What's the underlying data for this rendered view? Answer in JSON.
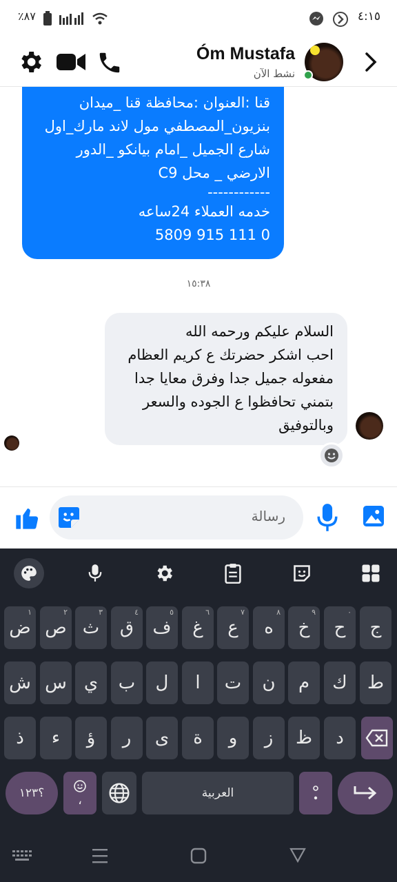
{
  "status": {
    "time": "٤:١٥",
    "battery": "٪٨٧"
  },
  "header": {
    "name": "Óm Mustafa",
    "sub": "نشط الآن"
  },
  "blue_message": {
    "lines": [
      "قنا :العنوان :محافظة قنا _ميدان",
      "بنزيون_المصطفي مول لاند مارك_اول",
      "شارع الجميل _امام بيانكو _الدور",
      "الارضي _ محل C9",
      "------------",
      "خدمه العملاء 24ساعه",
      "0 111 915 5809"
    ]
  },
  "timestamp": "١٥:٣٨",
  "gray_message": {
    "lines": [
      "السلام عليكم ورحمه الله",
      "احب اشكر حضرتك ع كريم العظام",
      "مفعوله جميل جدا وفرق معايا جدا",
      "بتمني تحافظوا ع الجوده والسعر",
      "وبالتوفيق"
    ]
  },
  "composer": {
    "placeholder": "رسالة"
  },
  "keyboard": {
    "row1": [
      "ج",
      "ح",
      "خ",
      "ه",
      "ع",
      "غ",
      "ف",
      "ق",
      "ث",
      "ص",
      "ض"
    ],
    "row1_digits": [
      "",
      "٠",
      "٩",
      "٨",
      "٧",
      "٦",
      "٥",
      "٤",
      "٣",
      "٢",
      "١"
    ],
    "row2": [
      "ط",
      "ك",
      "م",
      "ن",
      "ت",
      "ا",
      "ل",
      "ب",
      "ي",
      "س",
      "ش"
    ],
    "row3": [
      "د",
      "ظ",
      "ز",
      "و",
      "ة",
      "ى",
      "ر",
      "ؤ",
      "ء",
      "ذ"
    ],
    "space_label": "العربية",
    "symbols_label": "؟١٢٣",
    "comma": "،"
  },
  "colors": {
    "accent": "#0a7cff",
    "keyboard_bg": "#1f232c",
    "key_bg": "#3b3f49",
    "purple_key": "#5e4a6b"
  }
}
